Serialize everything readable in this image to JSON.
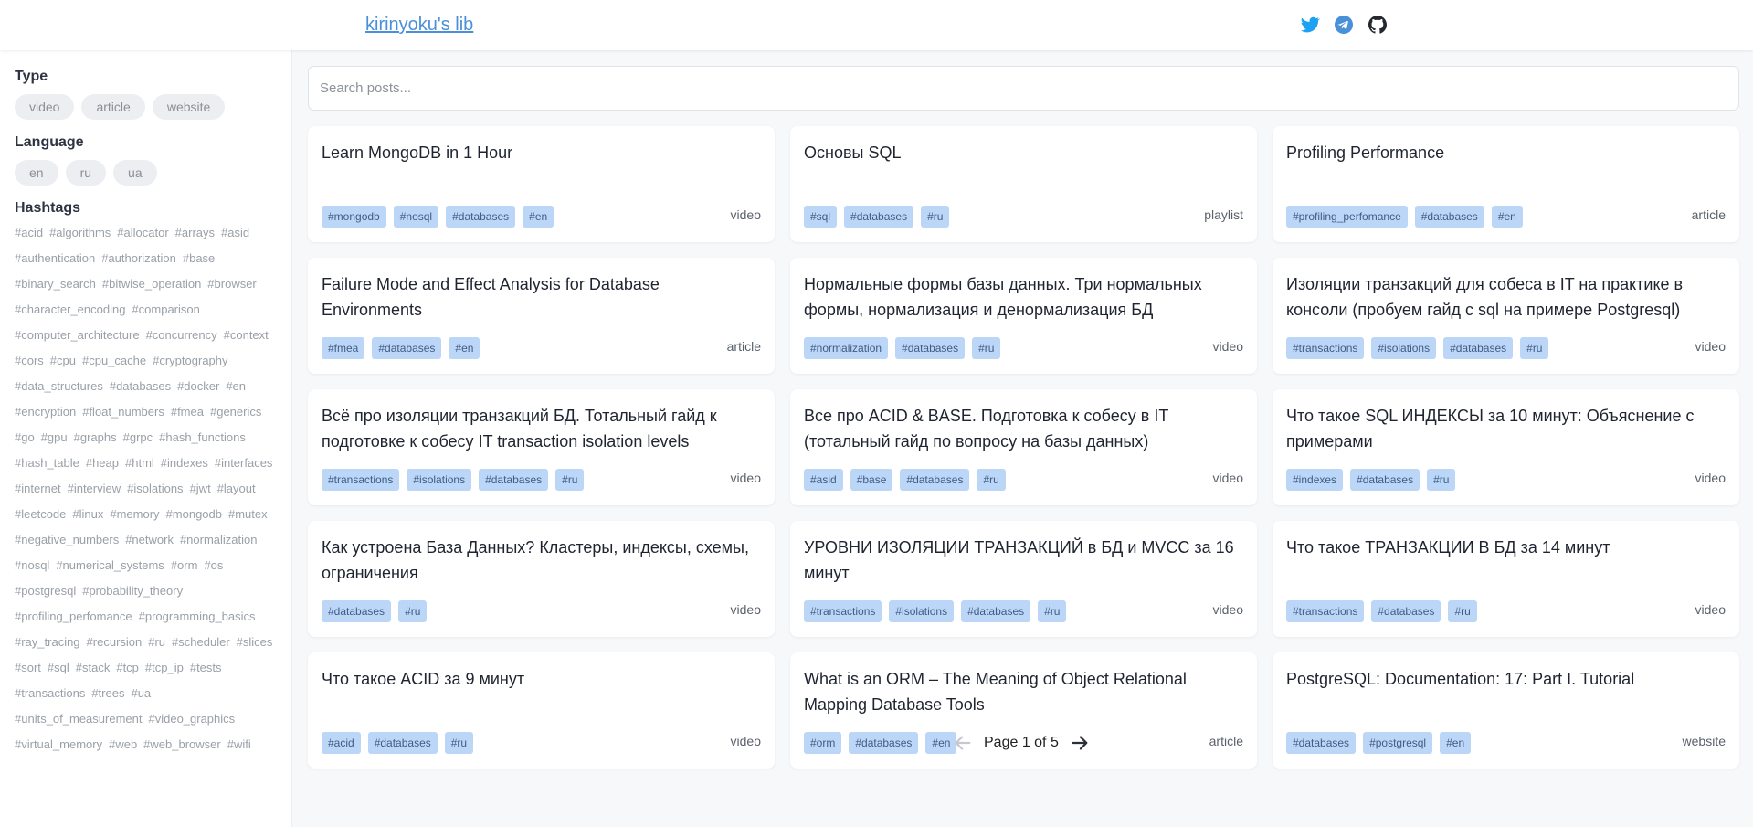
{
  "header": {
    "title": "kirinyoku's lib",
    "social": [
      "twitter-icon",
      "telegram-icon",
      "github-icon"
    ]
  },
  "sidebar": {
    "type": {
      "heading": "Type",
      "options": [
        "video",
        "article",
        "website"
      ]
    },
    "language": {
      "heading": "Language",
      "options": [
        "en",
        "ru",
        "ua"
      ]
    },
    "hashtags": {
      "heading": "Hashtags",
      "items": [
        "#acid",
        "#algorithms",
        "#allocator",
        "#arrays",
        "#asid",
        "#authentication",
        "#authorization",
        "#base",
        "#binary_search",
        "#bitwise_operation",
        "#browser",
        "#character_encoding",
        "#comparison",
        "#computer_architecture",
        "#concurrency",
        "#context",
        "#cors",
        "#cpu",
        "#cpu_cache",
        "#cryptography",
        "#data_structures",
        "#databases",
        "#docker",
        "#en",
        "#encryption",
        "#float_numbers",
        "#fmea",
        "#generics",
        "#go",
        "#gpu",
        "#graphs",
        "#grpc",
        "#hash_functions",
        "#hash_table",
        "#heap",
        "#html",
        "#indexes",
        "#interfaces",
        "#internet",
        "#interview",
        "#isolations",
        "#jwt",
        "#layout",
        "#leetcode",
        "#linux",
        "#memory",
        "#mongodb",
        "#mutex",
        "#negative_numbers",
        "#network",
        "#normalization",
        "#nosql",
        "#numerical_systems",
        "#orm",
        "#os",
        "#postgresql",
        "#probability_theory",
        "#profiling_perfomance",
        "#programming_basics",
        "#ray_tracing",
        "#recursion",
        "#ru",
        "#scheduler",
        "#slices",
        "#sort",
        "#sql",
        "#stack",
        "#tcp",
        "#tcp_ip",
        "#tests",
        "#transactions",
        "#trees",
        "#ua",
        "#units_of_measurement",
        "#video_graphics",
        "#virtual_memory",
        "#web",
        "#web_browser",
        "#wifi"
      ]
    }
  },
  "search": {
    "placeholder": "Search posts..."
  },
  "posts": [
    {
      "title": "Learn MongoDB in 1 Hour",
      "tags": [
        "#mongodb",
        "#nosql",
        "#databases",
        "#en"
      ],
      "type": "video"
    },
    {
      "title": "Основы SQL",
      "tags": [
        "#sql",
        "#databases",
        "#ru"
      ],
      "type": "playlist"
    },
    {
      "title": "Profiling Performance",
      "tags": [
        "#profiling_perfomance",
        "#databases",
        "#en"
      ],
      "type": "article"
    },
    {
      "title": "Failure Mode and Effect Analysis for Database Environments",
      "tags": [
        "#fmea",
        "#databases",
        "#en"
      ],
      "type": "article"
    },
    {
      "title": "Нормальные формы базы данных. Три нормальных формы, нормализация и денормализация БД",
      "tags": [
        "#normalization",
        "#databases",
        "#ru"
      ],
      "type": "video"
    },
    {
      "title": "Изоляции транзакций для собеса в IT на практике в консоли (пробуем гайд с sql на примере Postgresql)",
      "tags": [
        "#transactions",
        "#isolations",
        "#databases",
        "#ru"
      ],
      "type": "video"
    },
    {
      "title": "Всё про изоляции транзакций БД. Тотальный гайд к подготовке к собесу IT transaction isolation levels",
      "tags": [
        "#transactions",
        "#isolations",
        "#databases",
        "#ru"
      ],
      "type": "video"
    },
    {
      "title": "Все про ACID & BASE. Подготовка к собесу в IT (тотальный гайд по вопросу на базы данных)",
      "tags": [
        "#asid",
        "#base",
        "#databases",
        "#ru"
      ],
      "type": "video"
    },
    {
      "title": "Что такое SQL ИНДЕКСЫ за 10 минут: Объяснение с примерами",
      "tags": [
        "#indexes",
        "#databases",
        "#ru"
      ],
      "type": "video"
    },
    {
      "title": "Как устроена База Данных? Кластеры, индексы, схемы, ограничения",
      "tags": [
        "#databases",
        "#ru"
      ],
      "type": "video"
    },
    {
      "title": "УРОВНИ ИЗОЛЯЦИИ ТРАНЗАКЦИЙ в БД и MVCC за 16 минут",
      "tags": [
        "#transactions",
        "#isolations",
        "#databases",
        "#ru"
      ],
      "type": "video"
    },
    {
      "title": "Что такое ТРАНЗАКЦИИ В БД за 14 минут",
      "tags": [
        "#transactions",
        "#databases",
        "#ru"
      ],
      "type": "video"
    },
    {
      "title": "Что такое ACID за 9 минут",
      "tags": [
        "#acid",
        "#databases",
        "#ru"
      ],
      "type": "video"
    },
    {
      "title": "What is an ORM – The Meaning of Object Relational Mapping Database Tools",
      "tags": [
        "#orm",
        "#databases",
        "#en"
      ],
      "type": "article"
    },
    {
      "title": "PostgreSQL: Documentation: 17: Part I. Tutorial",
      "tags": [
        "#databases",
        "#postgresql",
        "#en"
      ],
      "type": "website"
    }
  ],
  "pagination": {
    "label": "Page 1 of 5",
    "prev_icon": "arrow-left-icon",
    "next_icon": "arrow-right-icon"
  },
  "colors": {
    "link": "#4a90d9",
    "tag_bg": "#bcd6f7",
    "tag_text": "#3f5c85",
    "twitter": "#1da1f2",
    "telegram": "#4a90d9"
  }
}
